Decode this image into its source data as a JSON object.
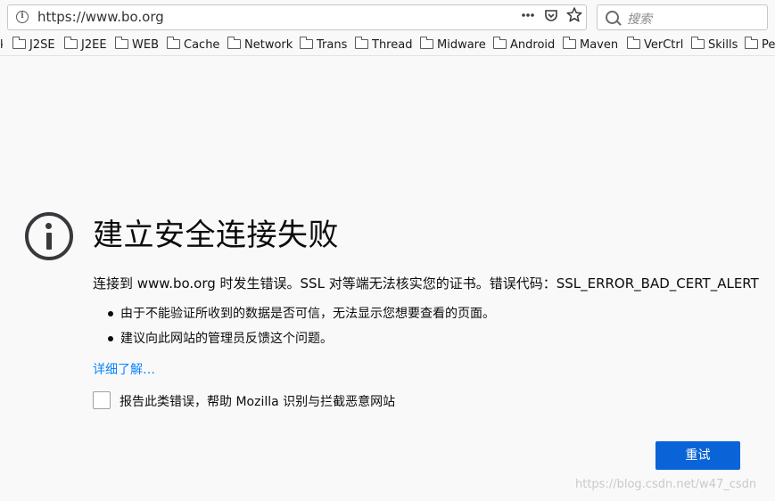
{
  "navbar": {
    "url": "https://www.bo.org",
    "actions": {
      "menu_icon": "ellipsis-icon",
      "pocket_icon": "pocket-icon",
      "bookmark_icon": "star-icon"
    },
    "search_placeholder": "搜索"
  },
  "bookmarks": {
    "items": [
      {
        "label": "J2SE",
        "icon": "folder-icon"
      },
      {
        "label": "J2EE",
        "icon": "folder-icon"
      },
      {
        "label": "WEB",
        "icon": "folder-icon"
      },
      {
        "label": "Cache",
        "icon": "folder-icon"
      },
      {
        "label": "Network",
        "icon": "folder-icon"
      },
      {
        "label": "Trans",
        "icon": "folder-icon"
      },
      {
        "label": "Thread",
        "icon": "folder-icon"
      },
      {
        "label": "Midware",
        "icon": "folder-icon"
      },
      {
        "label": "Android",
        "icon": "folder-icon"
      },
      {
        "label": "Maven",
        "icon": "folder-icon"
      },
      {
        "label": "VerCtrl",
        "icon": "folder-icon"
      },
      {
        "label": "Skills",
        "icon": "folder-icon"
      },
      {
        "label": "Pe",
        "icon": "folder-icon"
      }
    ]
  },
  "error": {
    "icon": "info-icon",
    "title": "建立安全连接失败",
    "description": "连接到 www.bo.org 时发生错误。SSL 对等端无法核实您的证书。错误代码：SSL_ERROR_BAD_CERT_ALERT",
    "bullets": [
      "由于不能验证所收到的数据是否可信，无法显示您想要查看的页面。",
      "建议向此网站的管理员反馈这个问题。"
    ],
    "learn_more": "详细了解…",
    "report_label": "报告此类错误，帮助 Mozilla 识别与拦截恶意网站",
    "report_checked": false,
    "retry_label": "重试"
  },
  "watermark": "https://blog.csdn.net/w47_csdn",
  "colors": {
    "link": "#0a84ff",
    "primary_button": "#0a64d8",
    "page_background": "#f9f9fa"
  }
}
